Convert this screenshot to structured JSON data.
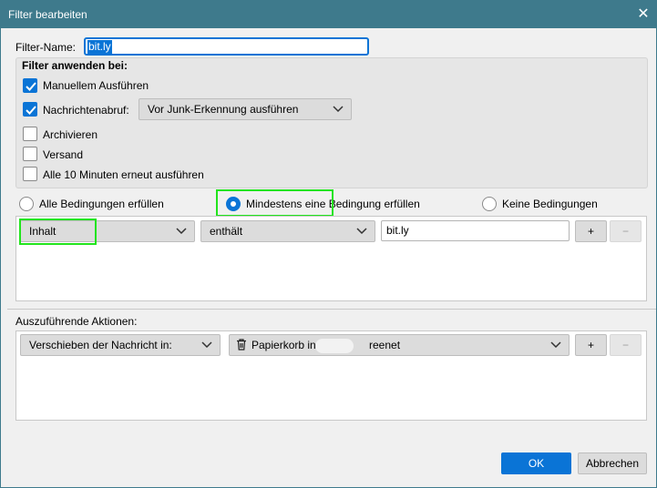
{
  "window": {
    "title": "Filter bearbeiten",
    "close_glyph": "✕"
  },
  "filter_name": {
    "label": "Filter-Name:",
    "value": "bit.ly"
  },
  "apply": {
    "heading": "Filter anwenden bei:",
    "manual": {
      "label": "Manuellem Ausführen",
      "checked": true
    },
    "getmail": {
      "label": "Nachrichtenabruf:",
      "checked": true,
      "select_value": "Vor Junk-Erkennung ausführen"
    },
    "archive": {
      "label": "Archivieren",
      "checked": false
    },
    "send": {
      "label": "Versand",
      "checked": false
    },
    "periodic": {
      "label": "Alle 10 Minuten erneut ausführen",
      "checked": false
    }
  },
  "match": {
    "all": "Alle Bedingungen erfüllen",
    "any": "Mindestens eine Bedingung erfüllen",
    "none": "Keine Bedingungen",
    "selected": "any"
  },
  "condition": {
    "field": "Inhalt",
    "operator": "enthält",
    "value": "bit.ly",
    "add": "+",
    "remove": "−"
  },
  "actions": {
    "heading": "Auszuführende Aktionen:",
    "type": "Verschieben der Nachricht in:",
    "target_prefix": "Papierkorb in",
    "target_suffix": "reenet",
    "add": "+",
    "remove": "−"
  },
  "buttons": {
    "ok": "OK",
    "cancel": "Abbrechen"
  },
  "colors": {
    "titlebar": "#3e7a8c",
    "accent": "#0a74d6",
    "highlight": "#22e41d"
  }
}
